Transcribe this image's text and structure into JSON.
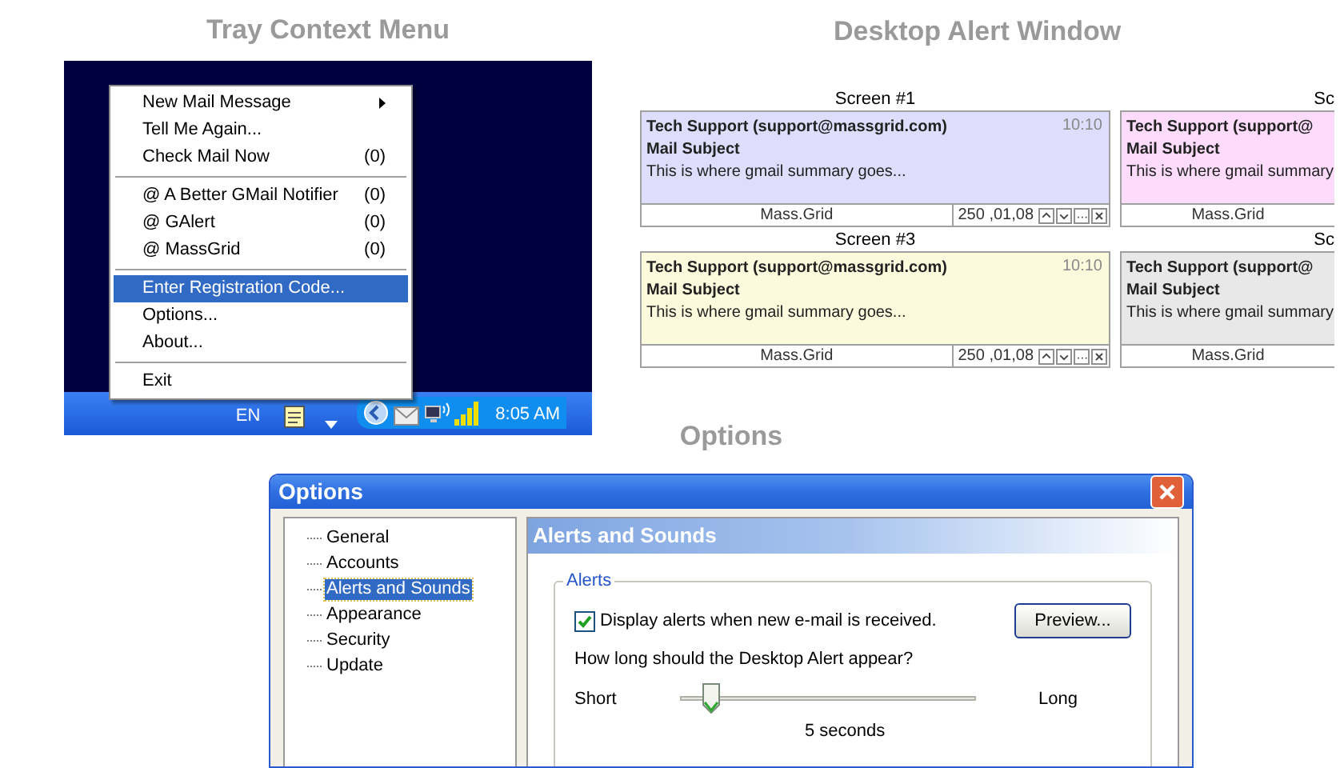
{
  "tray": {
    "title": "Tray Context Menu",
    "menu": [
      {
        "kind": "item",
        "label": "New Mail Message",
        "submenu": true,
        "selected": false
      },
      {
        "kind": "item",
        "label": "Tell Me Again...",
        "submenu": false,
        "selected": false
      },
      {
        "kind": "item",
        "label": "Check Mail Now",
        "count": "(0)",
        "submenu": false,
        "selected": false
      },
      {
        "kind": "separator"
      },
      {
        "kind": "item",
        "label": "@ A Better GMail Notifier",
        "count": "(0)",
        "submenu": false,
        "selected": false
      },
      {
        "kind": "item",
        "label": "@ GAlert",
        "count": "(0)",
        "submenu": false,
        "selected": false
      },
      {
        "kind": "item",
        "label": "@ MassGrid",
        "count": "(0)",
        "submenu": false,
        "selected": false
      },
      {
        "kind": "separator"
      },
      {
        "kind": "item",
        "label": "Enter Registration Code...",
        "submenu": false,
        "selected": true
      },
      {
        "kind": "item",
        "label": "Options...",
        "submenu": false,
        "selected": false
      },
      {
        "kind": "item",
        "label": "About...",
        "submenu": false,
        "selected": false
      },
      {
        "kind": "separator"
      },
      {
        "kind": "item",
        "label": "Exit",
        "submenu": false,
        "selected": false
      }
    ],
    "taskbar": {
      "language": "EN",
      "clock": "8:05 AM"
    }
  },
  "alerts": {
    "title": "Desktop Alert Window",
    "rows": [
      [
        {
          "label": "Screen #1",
          "sender": "Tech Support (support@massgrid.com)",
          "subject": "Mail Subject",
          "summary": "This is where gmail summary goes...",
          "time": "10:10",
          "footer": "Mass.Grid",
          "counter": "250 ,01,08",
          "color": "#dedefc"
        },
        {
          "label": "Sc",
          "sender": "Tech Support (support@",
          "subject": "Mail Subject",
          "summary": "This is where gmail summary",
          "footer": "Mass.Grid",
          "color": "#fcdcfa"
        }
      ],
      [
        {
          "label": "Screen #3",
          "sender": "Tech Support (support@massgrid.com)",
          "subject": "Mail Subject",
          "summary": "This is where gmail summary goes...",
          "time": "10:10",
          "footer": "Mass.Grid",
          "counter": "250 ,01,08",
          "color": "#fcfadc"
        },
        {
          "label": "Sc",
          "sender": "Tech Support (support@",
          "subject": "Mail Subject",
          "summary": "This is where gmail summary",
          "footer": "Mass.Grid",
          "color": "#e8e8e8"
        }
      ]
    ]
  },
  "options": {
    "heading": "Options",
    "window_title": "Options",
    "tree": [
      {
        "label": "General",
        "selected": false
      },
      {
        "label": "Accounts",
        "selected": false
      },
      {
        "label": "Alerts and Sounds",
        "selected": true
      },
      {
        "label": "Appearance",
        "selected": false
      },
      {
        "label": "Security",
        "selected": false
      },
      {
        "label": "Update",
        "selected": false
      }
    ],
    "panel_title": "Alerts and Sounds",
    "group": "Alerts",
    "checkbox": {
      "label": "Display alerts when new e-mail is received.",
      "checked": true
    },
    "preview_button": "Preview...",
    "question": "How long should the Desktop Alert appear?",
    "slider": {
      "min_label": "Short",
      "max_label": "Long",
      "level": 0.1,
      "reading": "5 seconds"
    }
  }
}
